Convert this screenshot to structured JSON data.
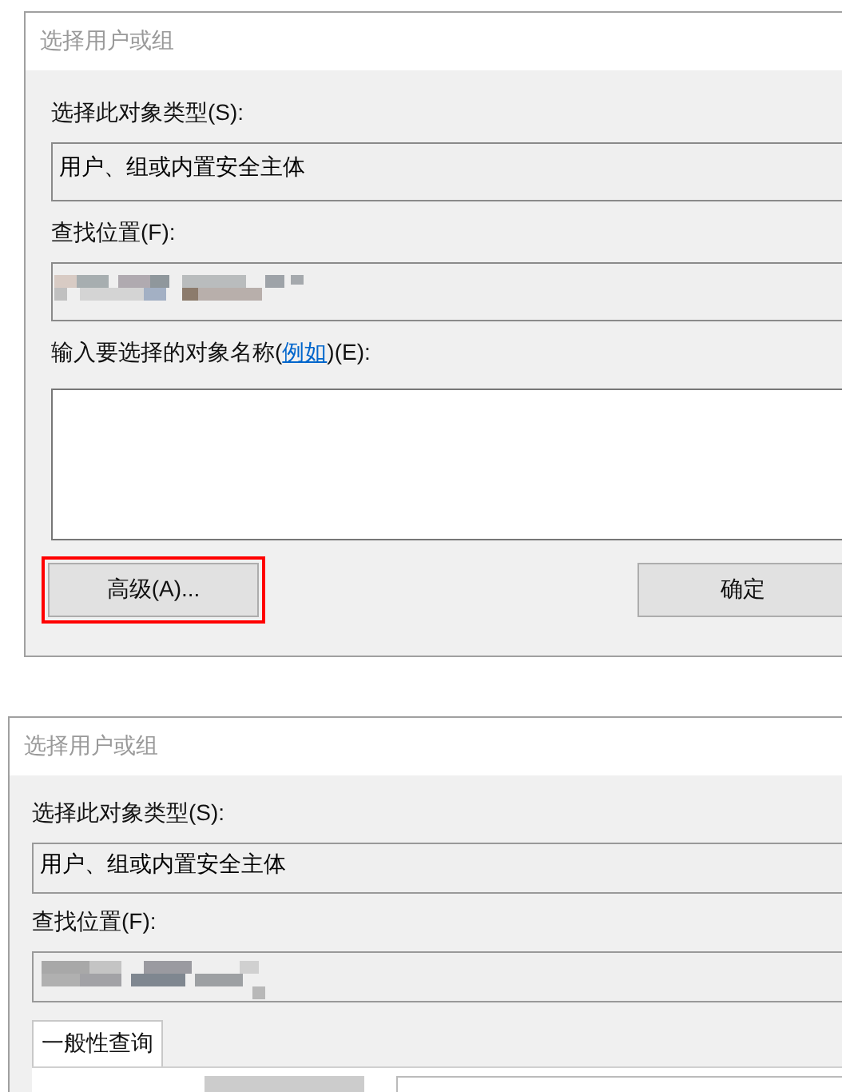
{
  "top_dialog": {
    "title": "选择用户或组",
    "object_type_label": "选择此对象类型(S):",
    "object_type": "用户、组或内置安全主体",
    "location_label": "查找位置(F):",
    "name_label_before": "输入要选择的对象名称(",
    "name_label_link": "例如",
    "name_label_after": ")(E):",
    "buttons": [
      {
        "label": "高级(A)...",
        "highlighted": true
      },
      {
        "label": "确定",
        "highlighted": false
      }
    ]
  },
  "bottom_dialog": {
    "title": "选择用户或组",
    "object_type_label": "选择此对象类型(S):",
    "object_type": "用户、组或内置安全主体",
    "location_label": "查找位置(F):",
    "tabs": [
      {
        "label": "一般性查询",
        "selected": true
      }
    ]
  }
}
